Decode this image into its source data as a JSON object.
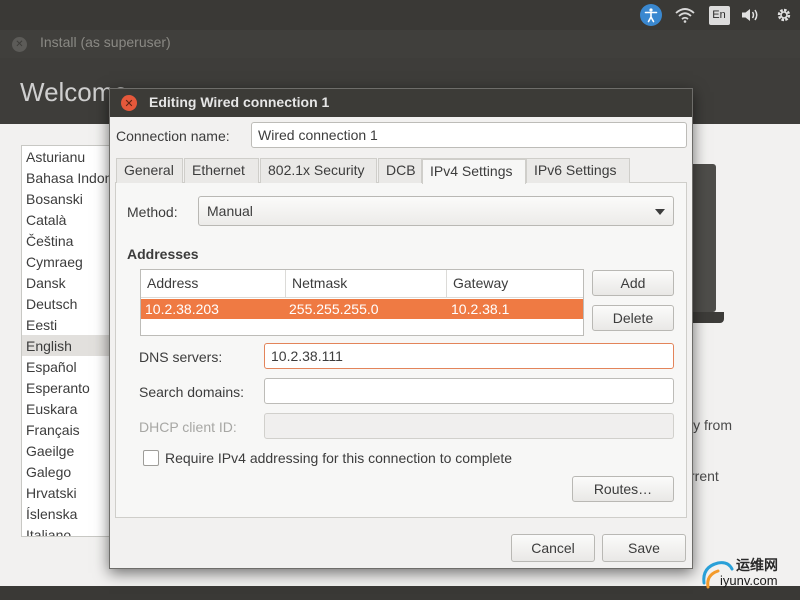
{
  "topbar": {
    "lang": "En",
    "icons": [
      "accessibility-icon",
      "wifi-icon",
      "keyboard-lang-icon",
      "volume-icon",
      "gear-icon"
    ]
  },
  "installer": {
    "title": "Install (as superuser)",
    "welcome": "Welcome",
    "languages": [
      "Asturianu",
      "Bahasa Indonesia",
      "Bosanski",
      "Català",
      "Čeština",
      "Cymraeg",
      "Dansk",
      "Deutsch",
      "Eesti",
      "English",
      "Español",
      "Esperanto",
      "Euskara",
      "Français",
      "Gaeilge",
      "Galego",
      "Hrvatski",
      "Íslenska",
      "Italiano"
    ],
    "selected_language": "English",
    "bg_text_1": "ly from",
    "bg_text_2": "rrent"
  },
  "dialog": {
    "title": "Editing Wired connection 1",
    "connection_name_label": "Connection name:",
    "connection_name_value": "Wired connection 1",
    "tabs": [
      "General",
      "Ethernet",
      "802.1x Security",
      "DCB",
      "IPv4 Settings",
      "IPv6 Settings"
    ],
    "active_tab": "IPv4 Settings",
    "method_label": "Method:",
    "method_value": "Manual",
    "addresses_heading": "Addresses",
    "columns": [
      "Address",
      "Netmask",
      "Gateway"
    ],
    "rows": [
      {
        "address": "10.2.38.203",
        "netmask": "255.255.255.0",
        "gateway": "10.2.38.1"
      }
    ],
    "add_button": "Add",
    "delete_button": "Delete",
    "dns_label": "DNS servers:",
    "dns_value": "10.2.38.111",
    "search_label": "Search domains:",
    "search_value": "",
    "dhcp_label": "DHCP client ID:",
    "dhcp_value": "",
    "require_label": "Require IPv4 addressing for this connection to complete",
    "require_checked": false,
    "routes_button": "Routes…",
    "cancel_button": "Cancel",
    "save_button": "Save"
  },
  "watermark": {
    "line1": "运维网",
    "line2": "iyunv.com"
  },
  "colors": {
    "accent": "#ef7a43",
    "close": "#e5583b",
    "panel": "#3a3936"
  }
}
